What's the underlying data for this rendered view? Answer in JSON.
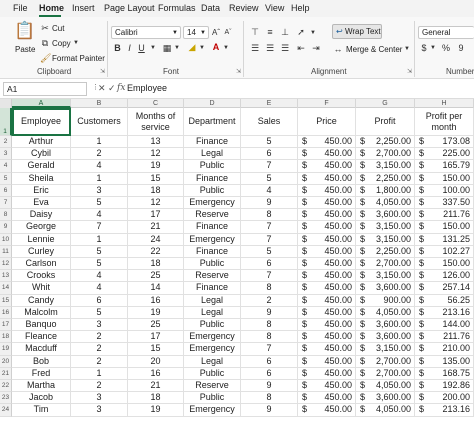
{
  "menu": {
    "tabs": [
      "File",
      "Home",
      "Insert",
      "Page Layout",
      "Formulas",
      "Data",
      "Review",
      "View",
      "Help"
    ],
    "active": "Home"
  },
  "clipboard": {
    "paste": "Paste",
    "cut": "Cut",
    "copy": "Copy",
    "format_painter": "Format Painter",
    "label": "Clipboard"
  },
  "font": {
    "name": "Calibri",
    "size": "14",
    "bold": "B",
    "italic": "I",
    "underline": "U",
    "label": "Font"
  },
  "alignment": {
    "wrap_text": "Wrap Text",
    "merge_center": "Merge & Center",
    "label": "Alignment"
  },
  "number": {
    "format": "General",
    "currency": "$",
    "percent": "%",
    "comma": "9",
    "label": "Number"
  },
  "formula_bar": {
    "name_box": "A1",
    "content": "Employee"
  },
  "columns": [
    "A",
    "B",
    "C",
    "D",
    "E",
    "F",
    "G",
    "H"
  ],
  "header_row": [
    "Employee",
    "Customers",
    "Months of service",
    "Department",
    "Sales",
    "Price",
    "Profit",
    "Profit per month"
  ],
  "rows": [
    [
      "Arthur",
      "1",
      "13",
      "Finance",
      "5",
      "450.00",
      "2,250.00",
      "173.08"
    ],
    [
      "Cybil",
      "2",
      "12",
      "Legal",
      "6",
      "450.00",
      "2,700.00",
      "225.00"
    ],
    [
      "Gerald",
      "4",
      "19",
      "Public",
      "7",
      "450.00",
      "3,150.00",
      "165.79"
    ],
    [
      "Sheila",
      "1",
      "15",
      "Finance",
      "5",
      "450.00",
      "2,250.00",
      "150.00"
    ],
    [
      "Eric",
      "3",
      "18",
      "Public",
      "4",
      "450.00",
      "1,800.00",
      "100.00"
    ],
    [
      "Eva",
      "5",
      "12",
      "Emergency",
      "9",
      "450.00",
      "4,050.00",
      "337.50"
    ],
    [
      "Daisy",
      "4",
      "17",
      "Reserve",
      "8",
      "450.00",
      "3,600.00",
      "211.76"
    ],
    [
      "George",
      "7",
      "21",
      "Finance",
      "7",
      "450.00",
      "3,150.00",
      "150.00"
    ],
    [
      "Lennie",
      "1",
      "24",
      "Emergency",
      "7",
      "450.00",
      "3,150.00",
      "131.25"
    ],
    [
      "Curley",
      "5",
      "22",
      "Finance",
      "5",
      "450.00",
      "2,250.00",
      "102.27"
    ],
    [
      "Carlson",
      "5",
      "18",
      "Public",
      "6",
      "450.00",
      "2,700.00",
      "150.00"
    ],
    [
      "Crooks",
      "4",
      "25",
      "Reserve",
      "7",
      "450.00",
      "3,150.00",
      "126.00"
    ],
    [
      "Whit",
      "4",
      "14",
      "Finance",
      "8",
      "450.00",
      "3,600.00",
      "257.14"
    ],
    [
      "Candy",
      "6",
      "16",
      "Legal",
      "2",
      "450.00",
      "900.00",
      "56.25"
    ],
    [
      "Malcolm",
      "5",
      "19",
      "Legal",
      "9",
      "450.00",
      "4,050.00",
      "213.16"
    ],
    [
      "Banquo",
      "3",
      "25",
      "Public",
      "8",
      "450.00",
      "3,600.00",
      "144.00"
    ],
    [
      "Fleance",
      "2",
      "17",
      "Emergency",
      "8",
      "450.00",
      "3,600.00",
      "211.76"
    ],
    [
      "Macduff",
      "2",
      "15",
      "Emergency",
      "7",
      "450.00",
      "3,150.00",
      "210.00"
    ],
    [
      "Bob",
      "2",
      "20",
      "Legal",
      "6",
      "450.00",
      "2,700.00",
      "135.00"
    ],
    [
      "Fred",
      "1",
      "16",
      "Public",
      "6",
      "450.00",
      "2,700.00",
      "168.75"
    ],
    [
      "Martha",
      "2",
      "21",
      "Reserve",
      "9",
      "450.00",
      "4,050.00",
      "192.86"
    ],
    [
      "Jacob",
      "3",
      "18",
      "Public",
      "8",
      "450.00",
      "3,600.00",
      "200.00"
    ],
    [
      "Tim",
      "3",
      "19",
      "Emergency",
      "9",
      "450.00",
      "4,050.00",
      "213.16"
    ]
  ],
  "colors": {
    "accent": "#1a7343",
    "selected_header": "#d3e4d8"
  }
}
